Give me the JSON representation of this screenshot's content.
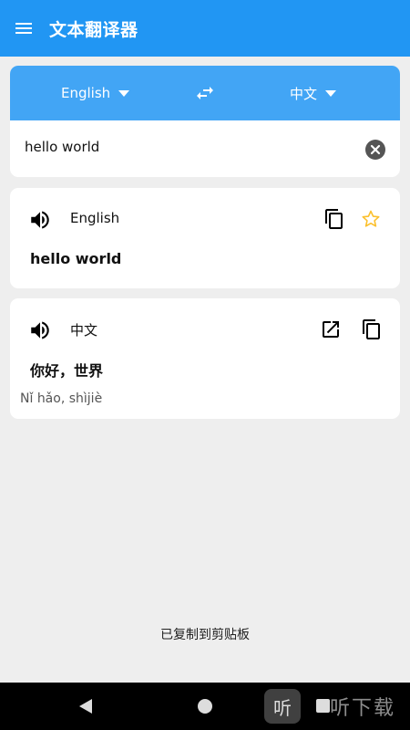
{
  "app": {
    "title": "文本翻译器"
  },
  "languages": {
    "source": "English",
    "target": "中文"
  },
  "input": {
    "text": "hello world"
  },
  "results": [
    {
      "lang": "English",
      "text": "hello world"
    },
    {
      "lang": "中文",
      "text": "你好，世界",
      "pinyin": "Nǐ hǎo, shìjiè"
    }
  ],
  "toast": "已复制到剪贴板",
  "watermark": {
    "badge": "听",
    "text": "听下载"
  },
  "colors": {
    "primary": "#2196f3",
    "lang_bar": "#42a5f5",
    "star": "#fbc02d"
  },
  "icons": [
    "menu-icon",
    "swap-icon",
    "clear-icon",
    "speaker-icon",
    "copy-icon",
    "star-icon",
    "open-external-icon"
  ]
}
